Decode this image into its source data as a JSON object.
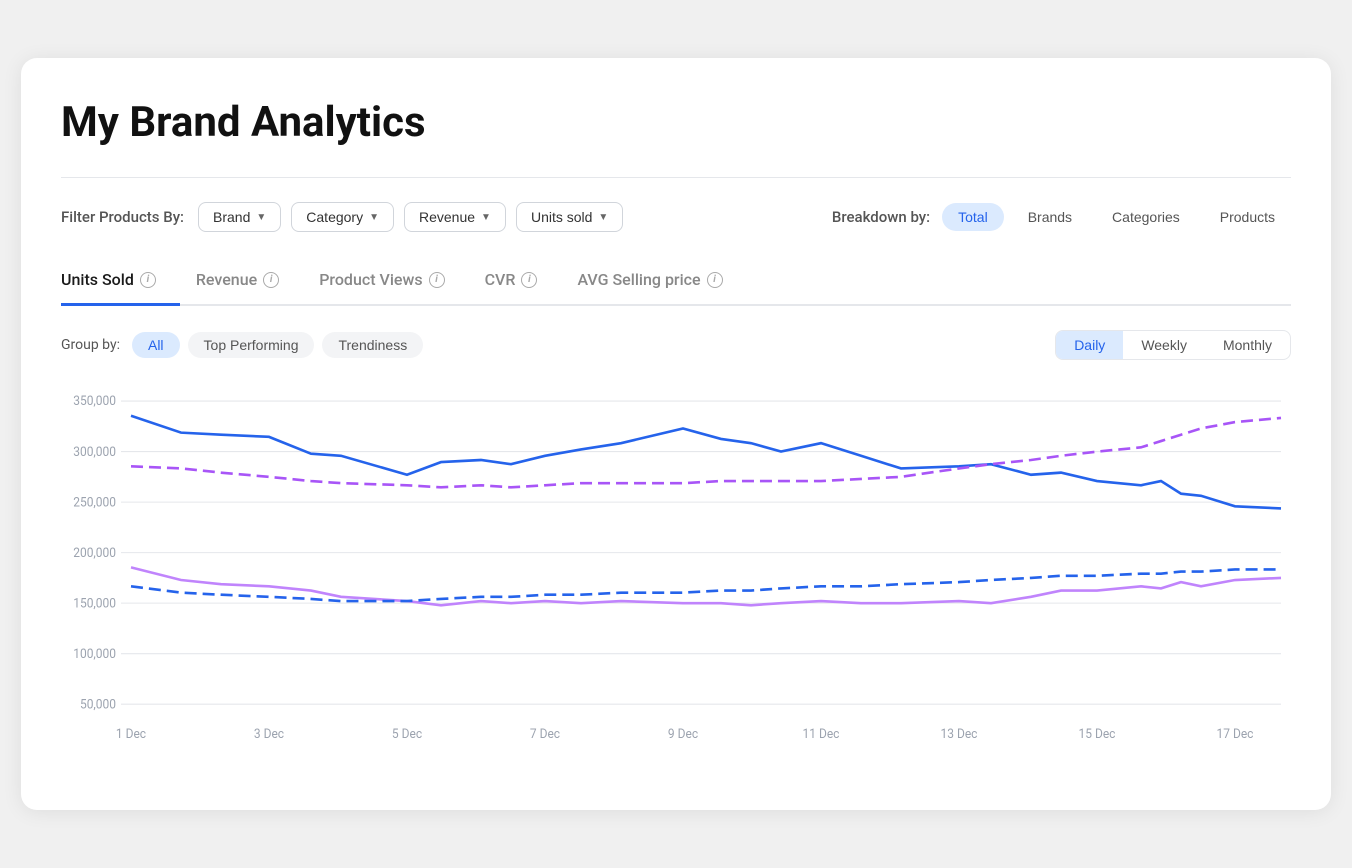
{
  "page": {
    "title": "My Brand Analytics"
  },
  "filters": {
    "label": "Filter Products By:",
    "items": [
      {
        "id": "brand",
        "label": "Brand"
      },
      {
        "id": "category",
        "label": "Category"
      },
      {
        "id": "revenue",
        "label": "Revenue"
      },
      {
        "id": "units_sold",
        "label": "Units sold"
      }
    ]
  },
  "breakdown": {
    "label": "Breakdown by:",
    "items": [
      {
        "id": "total",
        "label": "Total",
        "active": true
      },
      {
        "id": "brands",
        "label": "Brands",
        "active": false
      },
      {
        "id": "categories",
        "label": "Categories",
        "active": false
      },
      {
        "id": "products",
        "label": "Products",
        "active": false
      }
    ]
  },
  "tabs": [
    {
      "id": "units_sold",
      "label": "Units Sold",
      "active": true
    },
    {
      "id": "revenue",
      "label": "Revenue",
      "active": false
    },
    {
      "id": "product_views",
      "label": "Product Views",
      "active": false
    },
    {
      "id": "cvr",
      "label": "CVR",
      "active": false
    },
    {
      "id": "avg_selling_price",
      "label": "AVG Selling price",
      "active": false
    }
  ],
  "group": {
    "label": "Group by:",
    "items": [
      {
        "id": "all",
        "label": "All",
        "active": true
      },
      {
        "id": "top_performing",
        "label": "Top Performing",
        "active": false
      },
      {
        "id": "trendiness",
        "label": "Trendiness",
        "active": false
      }
    ]
  },
  "time_period": {
    "items": [
      {
        "id": "daily",
        "label": "Daily",
        "active": true
      },
      {
        "id": "weekly",
        "label": "Weekly",
        "active": false
      },
      {
        "id": "monthly",
        "label": "Monthly",
        "active": false
      }
    ]
  },
  "chart": {
    "y_labels": [
      "350,000",
      "300,000",
      "250,000",
      "200,000",
      "150,000",
      "100,000",
      "50,000"
    ],
    "x_labels": [
      "1 Dec",
      "3 Dec",
      "5 Dec",
      "7 Dec",
      "9 Dec",
      "11 Dec",
      "13 Dec",
      "15 Dec",
      "17 Dec"
    ]
  }
}
